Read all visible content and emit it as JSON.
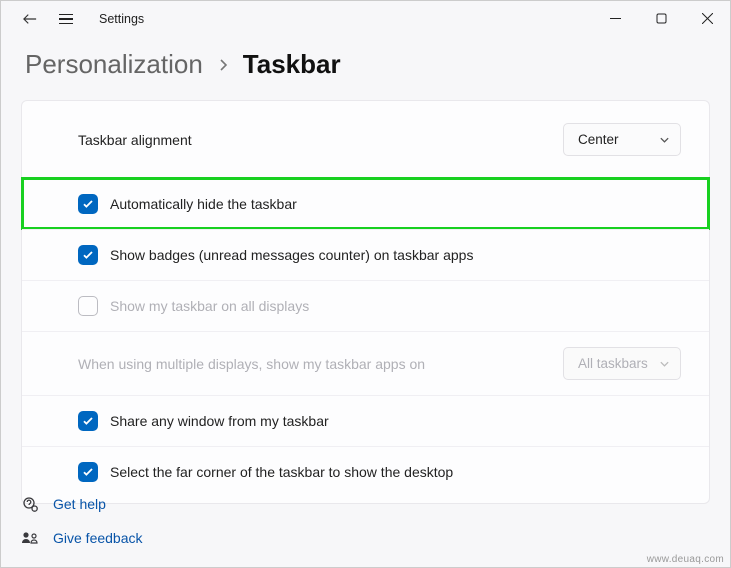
{
  "titlebar": {
    "title": "Settings"
  },
  "header": {
    "parent": "Personalization",
    "current": "Taskbar"
  },
  "alignment": {
    "label": "Taskbar alignment",
    "selected": "Center"
  },
  "options": {
    "auto_hide": "Automatically hide the taskbar",
    "show_badges": "Show badges (unread messages counter) on taskbar apps",
    "show_all_displays": "Show my taskbar on all displays",
    "multi_display_apps": "When using multiple displays, show my taskbar apps on",
    "multi_display_selected": "All taskbars",
    "share_window": "Share any window from my taskbar",
    "far_corner": "Select the far corner of the taskbar to show the desktop"
  },
  "footer": {
    "help": "Get help",
    "feedback": "Give feedback"
  },
  "watermark": "www.deuaq.com"
}
